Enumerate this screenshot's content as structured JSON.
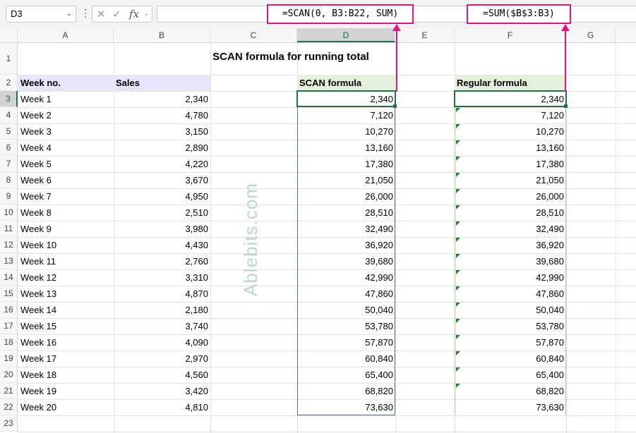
{
  "formula_bar": {
    "name_box": "D3",
    "fx_label": "fx",
    "formula": ""
  },
  "callouts": {
    "scan": "=SCAN(0, B3:B22, SUM)",
    "regular": "=SUM($B$3:B3)"
  },
  "columns": [
    "A",
    "B",
    "C",
    "D",
    "E",
    "F",
    "G"
  ],
  "rows": [
    "1",
    "2",
    "3",
    "4",
    "5",
    "6",
    "7",
    "8",
    "9",
    "10",
    "11",
    "12",
    "13",
    "14",
    "15",
    "16",
    "17",
    "18",
    "19",
    "20",
    "21",
    "22",
    "23"
  ],
  "sheet": {
    "title": "SCAN formula for running total",
    "header_week": "Week no.",
    "header_sales": "Sales",
    "header_scan": "SCAN formula",
    "header_regular": "Regular formula",
    "weeks": [
      "Week 1",
      "Week 2",
      "Week 3",
      "Week 4",
      "Week 5",
      "Week 6",
      "Week 7",
      "Week 8",
      "Week 9",
      "Week 10",
      "Week 11",
      "Week 12",
      "Week 13",
      "Week 14",
      "Week 15",
      "Week 16",
      "Week 17",
      "Week 18",
      "Week 19",
      "Week 20"
    ],
    "sales": [
      "2,340",
      "4,780",
      "3,150",
      "2,890",
      "4,220",
      "3,670",
      "4,950",
      "2,510",
      "3,980",
      "4,430",
      "2,760",
      "3,310",
      "4,870",
      "2,180",
      "3,740",
      "4,090",
      "2,970",
      "4,560",
      "3,420",
      "4,810"
    ],
    "scan": [
      "2,340",
      "7,120",
      "10,270",
      "13,160",
      "17,380",
      "21,050",
      "26,000",
      "28,510",
      "32,490",
      "36,920",
      "39,680",
      "42,990",
      "47,860",
      "50,040",
      "53,780",
      "57,870",
      "60,840",
      "65,400",
      "68,820",
      "73,630"
    ],
    "regular": [
      "2,340",
      "7,120",
      "10,270",
      "13,160",
      "17,380",
      "21,050",
      "26,000",
      "28,510",
      "32,490",
      "36,920",
      "39,680",
      "42,990",
      "47,860",
      "50,040",
      "53,780",
      "57,870",
      "60,840",
      "65,400",
      "68,820",
      "73,630"
    ]
  },
  "watermark": "Ablebits.com",
  "colors": {
    "accent": "#e0167d",
    "excel_green": "#217346",
    "header_blue": "#e5e5fb",
    "header_green": "#e4f0dc"
  }
}
